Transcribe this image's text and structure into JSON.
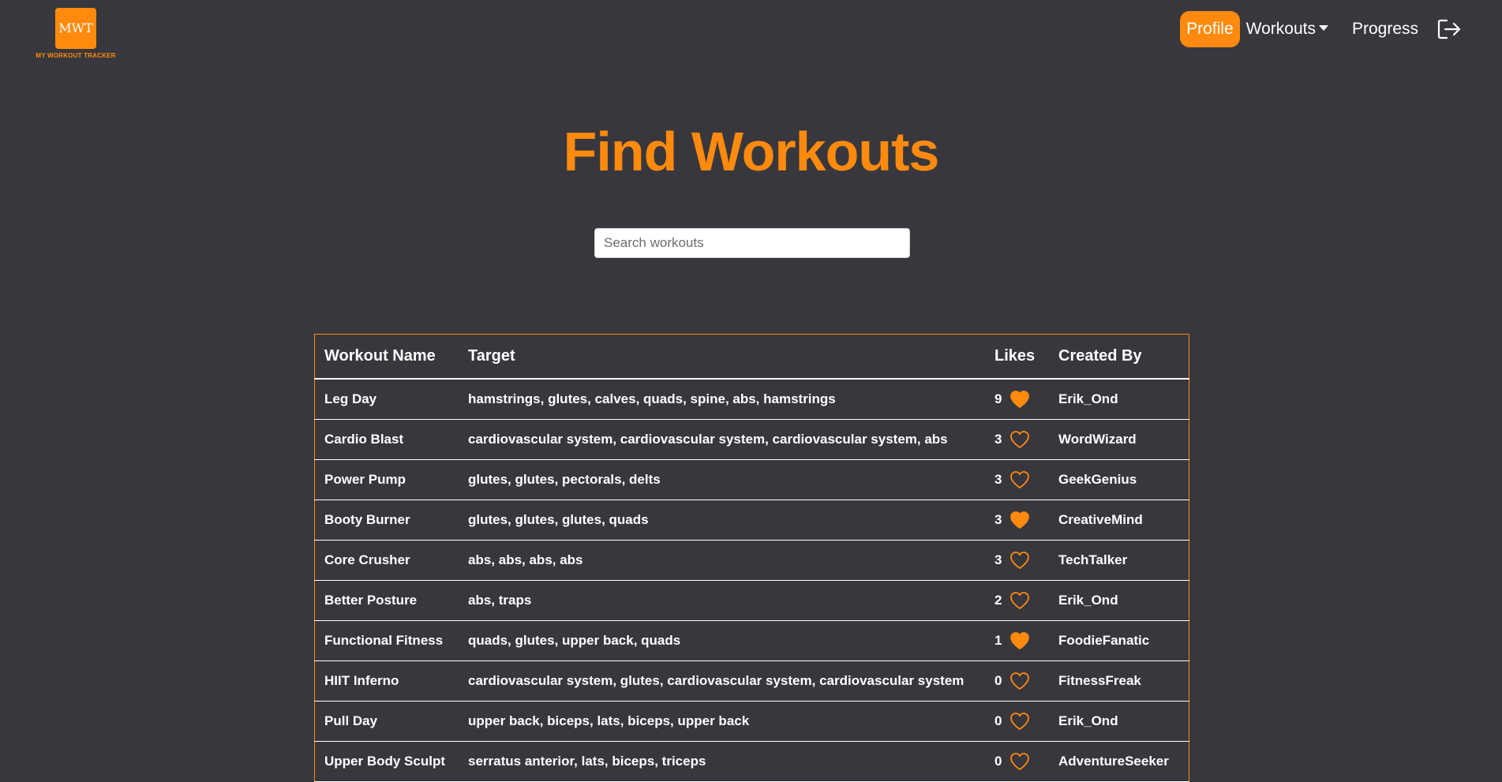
{
  "brand": {
    "logo_text": "MWT",
    "caption": "MY WORKOUT TRACKER",
    "accent_color": "#ff8a0d"
  },
  "nav": {
    "profile": "Profile",
    "workouts": "Workouts",
    "progress": "Progress",
    "logout_icon": "logout-icon"
  },
  "title": "Find Workouts",
  "search": {
    "placeholder": "Search workouts",
    "value": ""
  },
  "table": {
    "headers": [
      "Workout Name",
      "Target",
      "Likes",
      "Created By"
    ],
    "rows": [
      {
        "name": "Leg Day",
        "target": "hamstrings, glutes, calves, quads, spine, abs, hamstrings",
        "likes": "9",
        "liked": true,
        "creator": "Erik_Ond"
      },
      {
        "name": "Cardio Blast",
        "target": "cardiovascular system, cardiovascular system, cardiovascular system, abs",
        "likes": "3",
        "liked": false,
        "creator": "WordWizard"
      },
      {
        "name": "Power Pump",
        "target": "glutes, glutes, pectorals, delts",
        "likes": "3",
        "liked": false,
        "creator": "GeekGenius"
      },
      {
        "name": "Booty Burner",
        "target": "glutes, glutes, glutes, quads",
        "likes": "3",
        "liked": true,
        "creator": "CreativeMind"
      },
      {
        "name": "Core Crusher",
        "target": "abs, abs, abs, abs",
        "likes": "3",
        "liked": false,
        "creator": "TechTalker"
      },
      {
        "name": "Better Posture",
        "target": "abs, traps",
        "likes": "2",
        "liked": false,
        "creator": "Erik_Ond"
      },
      {
        "name": "Functional Fitness",
        "target": "quads, glutes, upper back, quads",
        "likes": "1",
        "liked": true,
        "creator": "FoodieFanatic"
      },
      {
        "name": "HIIT Inferno",
        "target": "cardiovascular system, glutes, cardiovascular system, cardiovascular system",
        "likes": "0",
        "liked": false,
        "creator": "FitnessFreak"
      },
      {
        "name": "Pull Day",
        "target": "upper back, biceps, lats, biceps, upper back",
        "likes": "0",
        "liked": false,
        "creator": "Erik_Ond"
      },
      {
        "name": "Upper Body Sculpt",
        "target": "serratus anterior, lats, biceps, triceps",
        "likes": "0",
        "liked": false,
        "creator": "AdventureSeeker"
      }
    ]
  }
}
